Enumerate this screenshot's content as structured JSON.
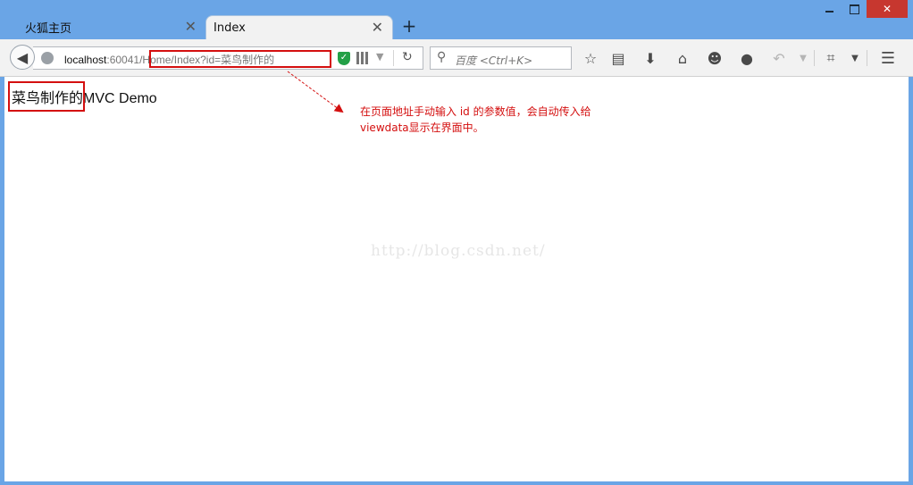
{
  "tabs": [
    {
      "label": "火狐主页",
      "active": false
    },
    {
      "label": "Index",
      "active": true
    }
  ],
  "window": {
    "close_glyph": "✕"
  },
  "address": {
    "host": "localhost",
    "port": ":60041/",
    "path": "Home/Index?id=菜鸟制作的"
  },
  "search": {
    "placeholder": "百度 <Ctrl+K>"
  },
  "page": {
    "heading_prefix": "菜鸟制作的",
    "heading_suffix": "MVC Demo"
  },
  "annotation": {
    "line1": "在页面地址手动输入 id 的参数值，会自动传入给",
    "line2": "viewdata显示在界面中。"
  },
  "watermark": "http://blog.csdn.net/",
  "colors": {
    "highlight": "#d40f0f",
    "titlebar": "#6aa5e6"
  },
  "icons": [
    "back-arrow-icon",
    "globe-icon",
    "shield-icon",
    "qr-icon",
    "reload-icon",
    "search-icon",
    "star-icon",
    "reading-list-icon",
    "download-icon",
    "home-icon",
    "smiley-icon",
    "chat-icon",
    "undo-icon",
    "crop-icon",
    "menu-icon"
  ]
}
